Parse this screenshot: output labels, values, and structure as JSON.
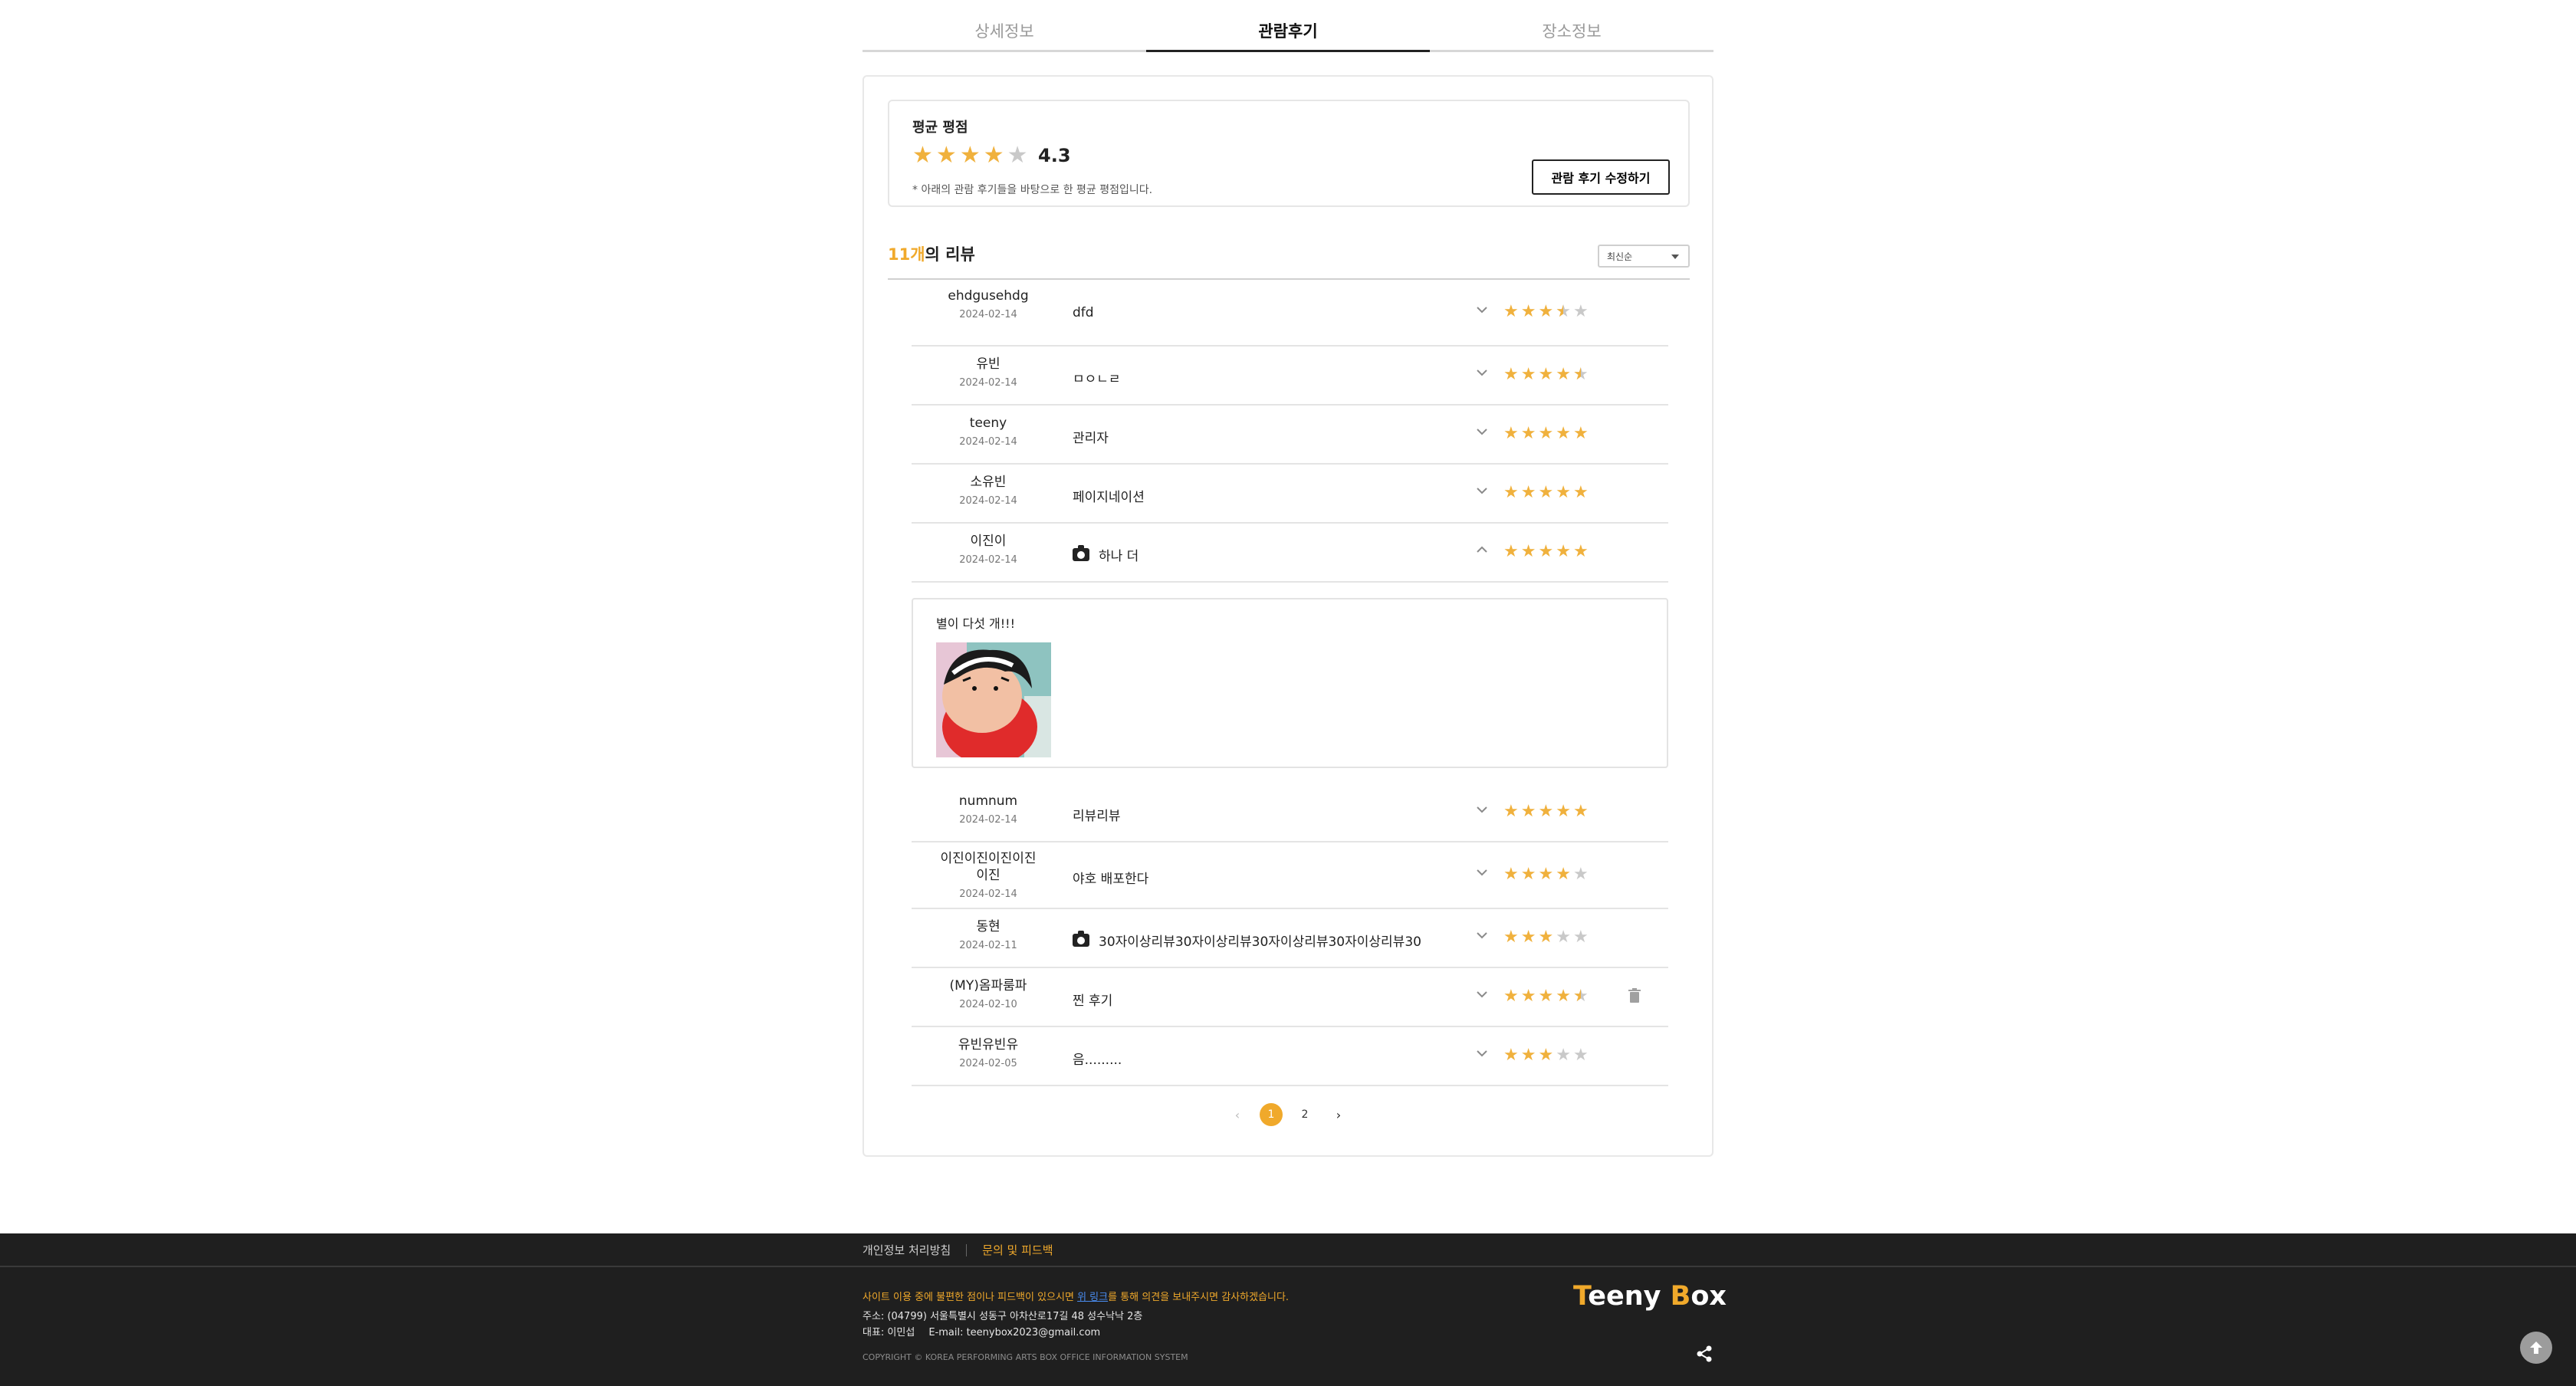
{
  "tabs": [
    {
      "label": "상세정보",
      "active": false
    },
    {
      "label": "관람후기",
      "active": true
    },
    {
      "label": "장소정보",
      "active": false
    }
  ],
  "summary": {
    "title": "평균 평점",
    "rating": 4.3,
    "score_text": "4.3",
    "note": "* 아래의 관람 후기들을 바탕으로 한 평균 평점입니다.",
    "edit_button": "관람 후기 수정하기"
  },
  "review_header": {
    "count": "11개",
    "count_suffix": "의 리뷰",
    "sort_value": "최신순"
  },
  "reviews": [
    {
      "name": "ehdgusehdg",
      "date": "2024-02-14",
      "title": "dfd",
      "rating": 3.5,
      "photo": false,
      "expanded": false,
      "deletable": false
    },
    {
      "name": "유빈",
      "date": "2024-02-14",
      "title": "ㅁㅇㄴㄹ",
      "rating": 4.5,
      "photo": false,
      "expanded": false,
      "deletable": false
    },
    {
      "name": "teeny",
      "date": "2024-02-14",
      "title": "관리자",
      "rating": 5,
      "photo": false,
      "expanded": false,
      "deletable": false
    },
    {
      "name": "소유빈",
      "date": "2024-02-14",
      "title": "페이지네이션",
      "rating": 5,
      "photo": false,
      "expanded": false,
      "deletable": false
    },
    {
      "name": "이진이",
      "date": "2024-02-14",
      "title": "하나 더",
      "rating": 5,
      "photo": true,
      "expanded": true,
      "deletable": false
    },
    {
      "name": "numnum",
      "date": "2024-02-14",
      "title": "리뷰리뷰",
      "rating": 5,
      "photo": false,
      "expanded": false,
      "deletable": false
    },
    {
      "name": "이진이진이진이진이진",
      "date": "2024-02-14",
      "title": "야호 배포한다",
      "rating": 4,
      "photo": false,
      "expanded": false,
      "deletable": false
    },
    {
      "name": "동현",
      "date": "2024-02-11",
      "title": "30자이상리뷰30자이상리뷰30자이상리뷰30자이상리뷰30",
      "rating": 3,
      "photo": true,
      "expanded": false,
      "deletable": false
    },
    {
      "name": "(MY)옴파룸파",
      "date": "2024-02-10",
      "title": "찐 후기",
      "rating": 4.5,
      "photo": false,
      "expanded": false,
      "deletable": true
    },
    {
      "name": "유빈유빈유",
      "date": "2024-02-05",
      "title": "음.........",
      "rating": 3,
      "photo": false,
      "expanded": false,
      "deletable": false
    }
  ],
  "expanded_detail": {
    "text": "별이 다섯 개!!!"
  },
  "pagination": {
    "pages": [
      "1",
      "2"
    ],
    "current": "1"
  },
  "footer": {
    "link_privacy": "개인정보 처리방침",
    "link_feedback": "문의 및 피드백",
    "notice_before": "사이트 이용 중에 불편한 점이나 피드백이 있으시면 ",
    "notice_link": "위 링크",
    "notice_after": "를 통해 의견을 보내주시면 감사하겠습니다.",
    "address": "주소: (04799) 서울특별시 성동구 아차산로17길 48 성수낙낙 2층",
    "ceo": "대표: 이민섭",
    "email": "E-mail: teenybox2023@gmail.com",
    "copyright": "COPYRIGHT © KOREA PERFORMING ARTS BOX OFFICE INFORMATION SYSTEM",
    "brand_first_letter": "T",
    "brand_part1": "eeny ",
    "brand_second_letter": "B",
    "brand_part2": "ox"
  },
  "colors": {
    "accent": "#f0a92b",
    "star_filled": "#f0b13d",
    "star_empty": "#c9c9c9",
    "footer_bg": "#1f1f1f",
    "link_blue": "#4a8cf0"
  },
  "icons": [
    "chevron-down-icon",
    "chevron-up-icon",
    "star-icon",
    "camera-icon",
    "trash-icon",
    "share-icon",
    "arrow-up-icon",
    "chevron-left-icon",
    "chevron-right-icon"
  ]
}
